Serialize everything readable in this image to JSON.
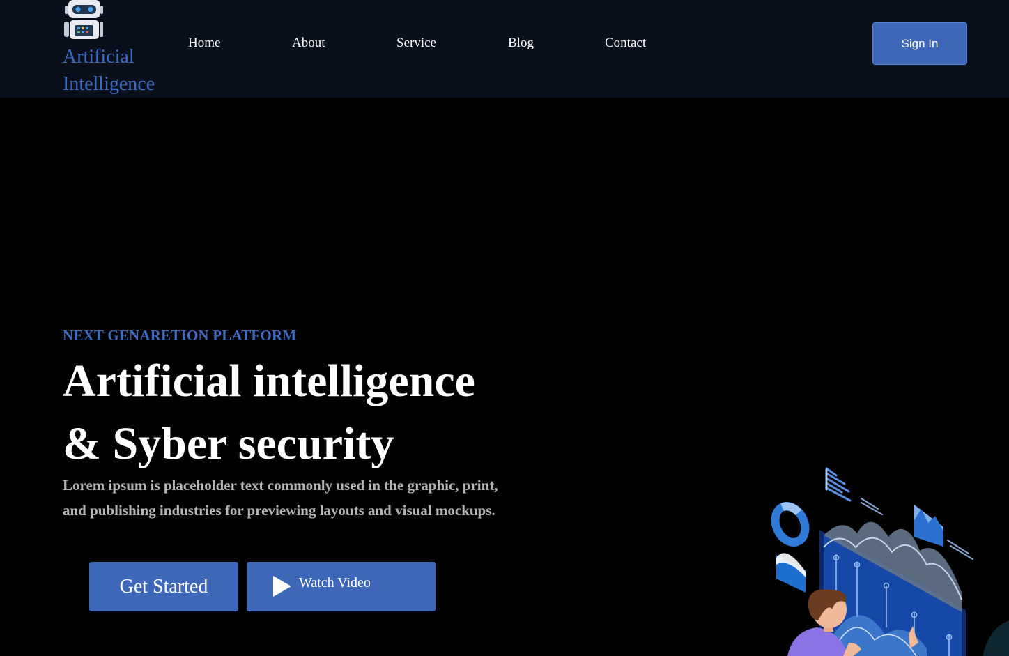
{
  "brand": {
    "icon": "robot-icon",
    "line1": "Artificial",
    "line2": "Intelligence"
  },
  "nav": {
    "links": [
      "Home",
      "About",
      "Service",
      "Blog",
      "Contact"
    ],
    "signin_label": "Sign In"
  },
  "hero": {
    "eyebrow": "NEXT GENARETION PLATFORM",
    "title_line1": "Artificial intelligence",
    "title_line2": "& Syber security",
    "desc_line1": "Lorem ipsum is placeholder text commonly used in the graphic, print,",
    "desc_line2": "and publishing industries for previewing layouts and visual mockups.",
    "primary_button": "Get Started",
    "video_button": "Watch Video",
    "video_icon": "play-icon",
    "illustration": "person-dashboard-illustration"
  },
  "colors": {
    "accent": "#3e68b7",
    "nav_bg": "#0a0f1c",
    "page_bg": "#000000",
    "brand_text": "#3e6bc2"
  }
}
